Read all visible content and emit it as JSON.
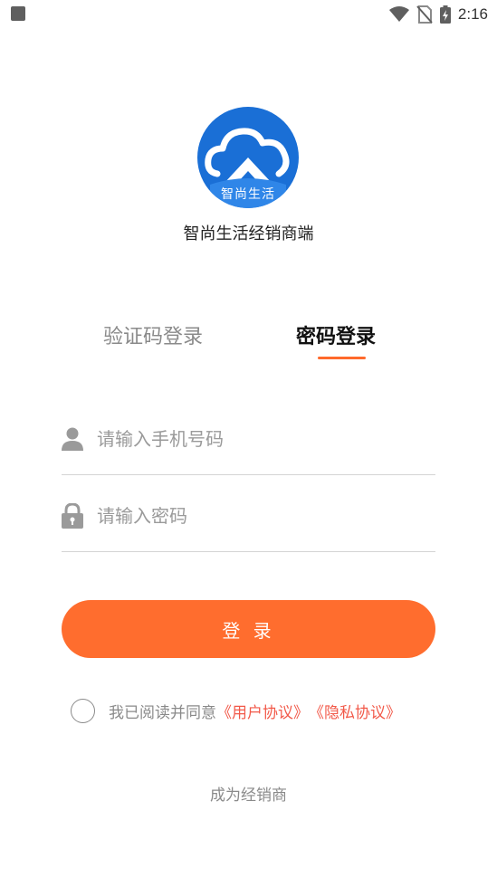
{
  "status_bar": {
    "time": "2:16",
    "icons": [
      "wifi-icon",
      "no-sim-icon",
      "battery-charging-icon"
    ]
  },
  "logo": {
    "caption": "智尚生活",
    "colors": {
      "background": "#1a6fd6",
      "mark": "#ffffff"
    }
  },
  "app_name": "智尚生活经销商端",
  "tabs": [
    {
      "label": "验证码登录",
      "active": false
    },
    {
      "label": "密码登录",
      "active": true
    }
  ],
  "form": {
    "phone": {
      "value": "",
      "placeholder": "请输入手机号码",
      "icon": "user-icon"
    },
    "password": {
      "value": "",
      "placeholder": "请输入密码",
      "icon": "lock-icon"
    }
  },
  "login_button": {
    "label": "登 录"
  },
  "agreement": {
    "checked": false,
    "text": "我已阅读并同意",
    "user_agreement": "《用户协议》",
    "privacy_policy": "《隐私协议》"
  },
  "become_dealer": "成为经销商",
  "colors": {
    "accent": "#ff6d2e",
    "link": "#f25a4a",
    "muted_text": "#8a8a8a",
    "divider": "#d4d4d4"
  }
}
